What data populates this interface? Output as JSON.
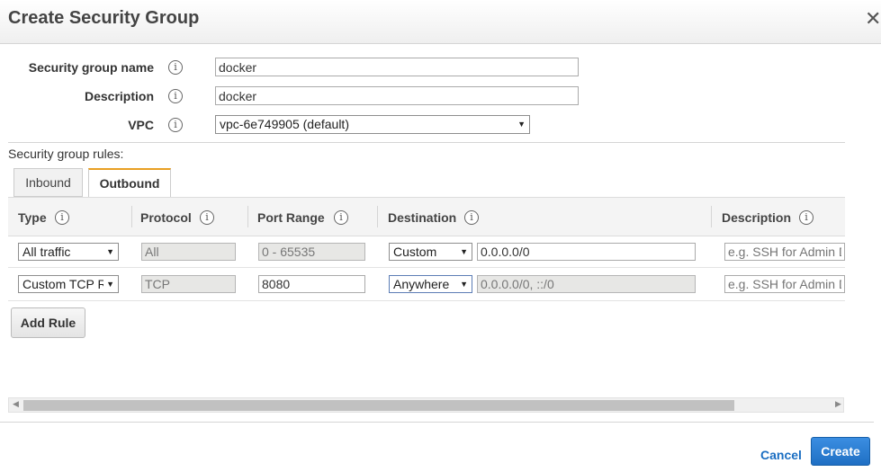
{
  "dialog": {
    "title": "Create Security Group",
    "close_glyph": "✕"
  },
  "form": {
    "name_label": "Security group name",
    "name_value": "docker",
    "desc_label": "Description",
    "desc_value": "docker",
    "vpc_label": "VPC",
    "vpc_value": "vpc-6e749905 (default)",
    "info_glyph": "i"
  },
  "rules": {
    "label": "Security group rules:",
    "tabs": [
      {
        "label": "Inbound",
        "active": false
      },
      {
        "label": "Outbound",
        "active": true
      }
    ],
    "columns": [
      "Type",
      "Protocol",
      "Port Range",
      "Destination",
      "Description"
    ],
    "rows": [
      {
        "type": "All traffic",
        "protocol": "All",
        "port_range": "0 - 65535",
        "dest_mode": "Custom",
        "dest_value": "0.0.0.0/0",
        "description_placeholder": "e.g. SSH for Admin Desktop"
      },
      {
        "type": "Custom TCP Rule",
        "protocol": "TCP",
        "port_range": "8080",
        "dest_mode": "Anywhere",
        "dest_value": "0.0.0.0/0, ::/0",
        "description_placeholder": "e.g. SSH for Admin Desktop"
      }
    ],
    "add_rule_label": "Add Rule"
  },
  "footer": {
    "cancel_label": "Cancel",
    "create_label": "Create"
  },
  "icons": {
    "dropdown": "chevron-down-icon",
    "info": "info-icon"
  }
}
